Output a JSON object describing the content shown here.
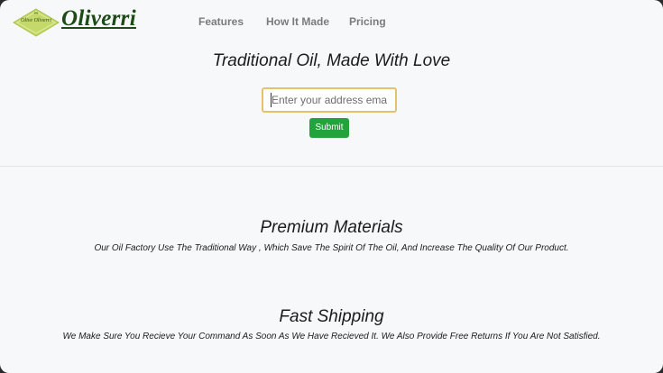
{
  "logo": {
    "tag_text": "Olive Oliverri",
    "wordmark": "Oliverri",
    "colors": {
      "diamond": "#c5d96a",
      "text": "#1d4a17"
    }
  },
  "nav": {
    "items": [
      {
        "label": "Features"
      },
      {
        "label": "How It Made"
      },
      {
        "label": "Pricing"
      }
    ]
  },
  "hero": {
    "title": "Traditional Oil, Made With Love",
    "email_placeholder": "Enter your address email",
    "submit_label": "Submit"
  },
  "features": [
    {
      "title": "Premium Materials",
      "text": "Our Oil Factory Use The Traditional Way , Which Save The Spirit Of The Oil, And Increase The Quality Of Our Product."
    },
    {
      "title": "Fast Shipping",
      "text": "We Make Sure You Recieve Your Command As Soon As We Have Recieved It. We Also Provide Free Returns If You Are Not Satisfied."
    }
  ],
  "colors": {
    "page_background": "#f7f8fa",
    "button": "#23a33b",
    "input_border": "#e6c06a"
  }
}
